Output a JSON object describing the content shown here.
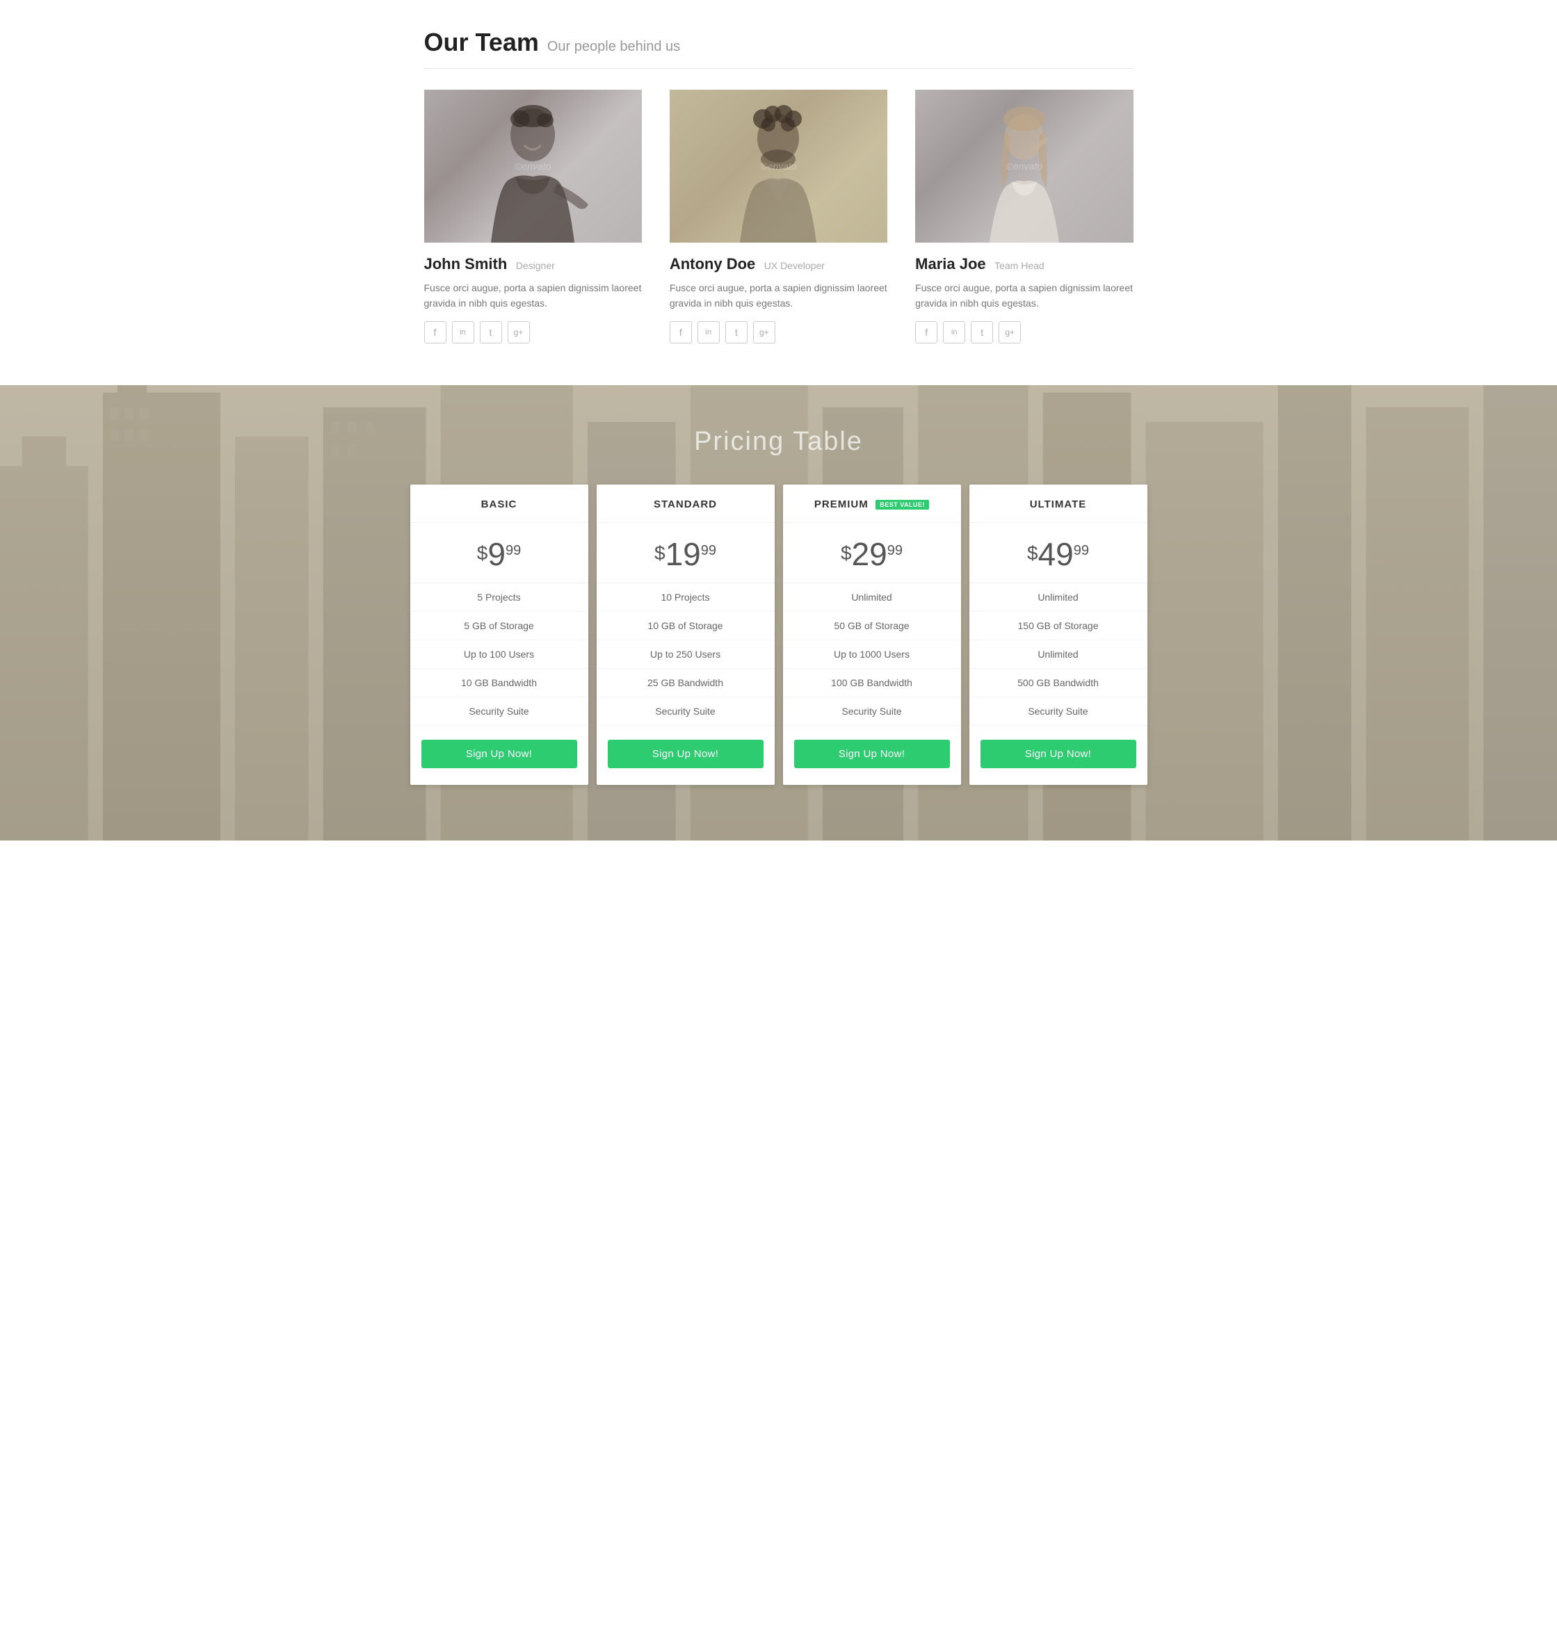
{
  "ourTeam": {
    "title": "Our Team",
    "subtitle": "Our people behind us",
    "members": [
      {
        "id": "john-smith",
        "name": "John Smith",
        "role": "Designer",
        "bio": "Fusce orci augue, porta a sapien dignissim laoreet gravida in nibh quis egestas.",
        "photoClass": "photo-john",
        "socials": [
          "f",
          "in",
          "t",
          "g+"
        ]
      },
      {
        "id": "antony-doe",
        "name": "Antony Doe",
        "role": "UX Developer",
        "bio": "Fusce orci augue, porta a sapien dignissim laoreet gravida in nibh quis egestas.",
        "photoClass": "photo-antony",
        "socials": [
          "f",
          "in",
          "t",
          "g+"
        ]
      },
      {
        "id": "maria-joe",
        "name": "Maria Joe",
        "role": "Team Head",
        "bio": "Fusce orci augue, porta a sapien dignissim laoreet gravida in nibh quis egestas.",
        "photoClass": "photo-maria",
        "socials": [
          "f",
          "in",
          "t",
          "g+"
        ]
      }
    ]
  },
  "pricing": {
    "title": "Pricing Table",
    "plans": [
      {
        "id": "basic",
        "name": "BASIC",
        "bestValue": false,
        "priceWhole": "$9",
        "priceCents": "99",
        "features": [
          "5 Projects",
          "5 GB of Storage",
          "Up to 100 Users",
          "10 GB Bandwidth",
          "Security Suite"
        ],
        "cta": "Sign Up Now!"
      },
      {
        "id": "standard",
        "name": "STANDARD",
        "bestValue": false,
        "priceWhole": "$19",
        "priceCents": "99",
        "features": [
          "10 Projects",
          "10 GB of Storage",
          "Up to 250 Users",
          "25 GB Bandwidth",
          "Security Suite"
        ],
        "cta": "Sign Up Now!"
      },
      {
        "id": "premium",
        "name": "PREMIUM",
        "bestValue": true,
        "bestValueLabel": "BEST VALUE!",
        "priceWhole": "$29",
        "priceCents": "99",
        "features": [
          "Unlimited",
          "50 GB of Storage",
          "Up to 1000 Users",
          "100 GB Bandwidth",
          "Security Suite"
        ],
        "cta": "Sign Up Now!"
      },
      {
        "id": "ultimate",
        "name": "ULTIMATE",
        "bestValue": false,
        "priceWhole": "$49",
        "priceCents": "99",
        "features": [
          "Unlimited",
          "150 GB of Storage",
          "Unlimited",
          "500 GB Bandwidth",
          "Security Suite"
        ],
        "cta": "Sign Up Now!"
      }
    ]
  },
  "icons": {
    "facebook": "f",
    "linkedin": "in",
    "twitter": "t",
    "googleplus": "g+"
  }
}
